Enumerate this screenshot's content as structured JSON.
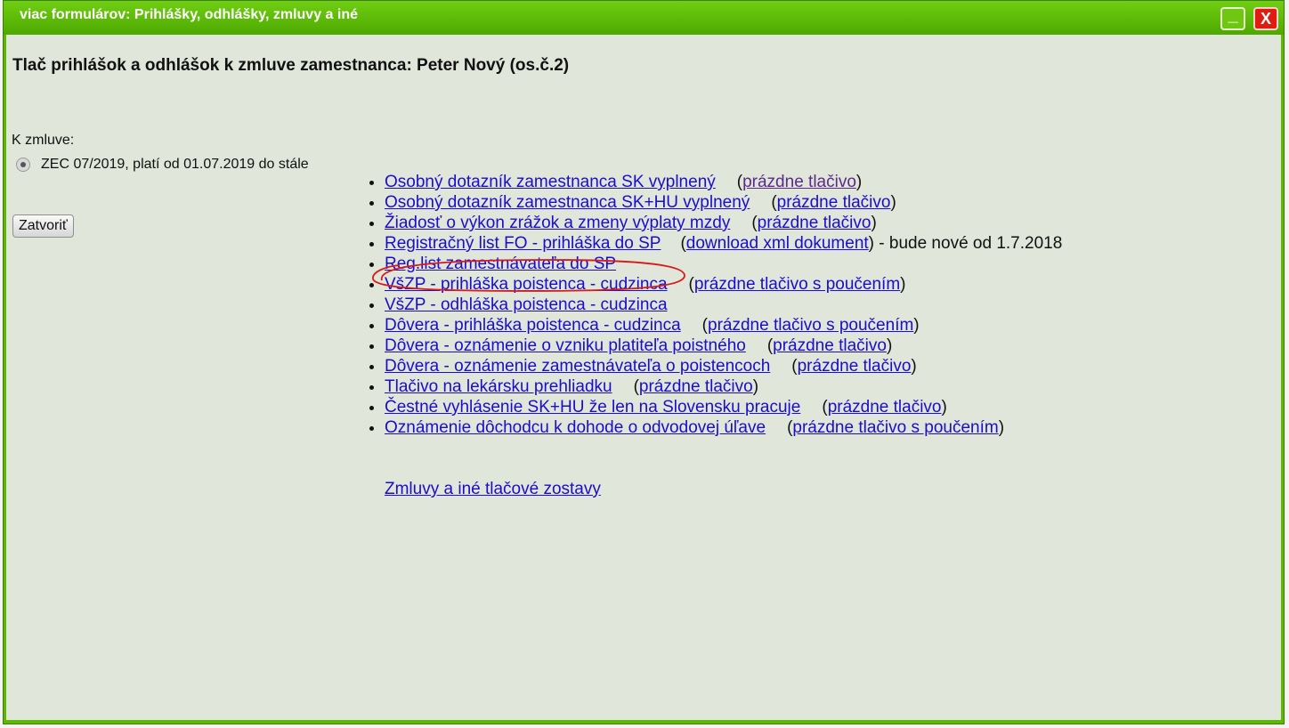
{
  "window": {
    "title": "viac formulárov: Prihlášky, odhlášky, zmluvy a iné",
    "minimize_label": "_",
    "close_label": "X"
  },
  "page": {
    "heading": "Tlač prihlášok a odhlášok k zmluve zamestnanca: Peter Nový (os.č.2)",
    "contract_label": "K zmluve:",
    "contract_option": "ZEC 07/2019, platí od 01.07.2019 do stále",
    "close_button": "Zatvoriť"
  },
  "forms": [
    {
      "name": "Osobný dotazník zamestnanca SK vyplnený",
      "extra": "prázdne tlačivo",
      "extra_visited": true
    },
    {
      "name": "Osobný dotazník zamestnanca SK+HU vyplnený",
      "extra": "prázdne tlačivo"
    },
    {
      "name": "Žiadosť o výkon zrážok a zmeny výplaty mzdy",
      "extra": "prázdne tlačivo"
    },
    {
      "name": "Registračný list FO - prihláška do SP",
      "extra": "download xml dokument",
      "note": " - bude nové od 1.7.2018",
      "highlighted": true
    },
    {
      "name": "Reg.list zamestnávateľa do SP"
    },
    {
      "name": "VšZP - prihláška poistenca - cudzinca",
      "extra": "prázdne tlačivo s poučením"
    },
    {
      "name": "VšZP - odhláška poistenca - cudzinca"
    },
    {
      "name": "Dôvera - prihláška poistenca - cudzinca",
      "extra": "prázdne tlačivo s poučením"
    },
    {
      "name": "Dôvera - oznámenie o vzniku platiteľa poistného",
      "extra": "prázdne tlačivo"
    },
    {
      "name": "Dôvera - oznámenie zamestnávateľa o poistencoch",
      "extra": "prázdne tlačivo"
    },
    {
      "name": "Tlačivo na lekársku prehliadku",
      "extra": "prázdne tlačivo"
    },
    {
      "name": "Čestné vyhlásenie SK+HU že len na Slovensku pracuje",
      "extra": "prázdne tlačivo"
    },
    {
      "name": "Oznámenie dôchodcu k dohode o odvodovej úľave",
      "extra": "prázdne tlačivo s poučením"
    }
  ],
  "extra_link": "Zmluvy a iné tlačové zostavy",
  "colors": {
    "titlebar": "#5cb800",
    "close_button": "#e01b0f",
    "content_bg": "#e0e6d9",
    "link": "#1a0dcc",
    "annotation": "#d81a1a"
  }
}
